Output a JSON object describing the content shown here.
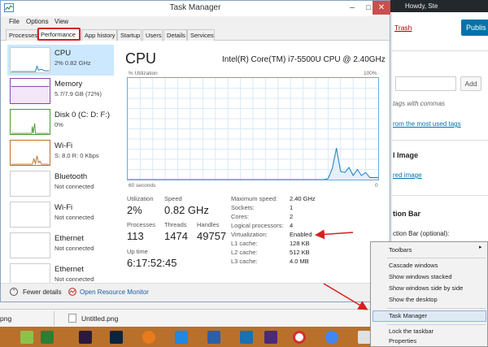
{
  "wp": {
    "admin_user": "Howdy, Ste",
    "trash": "Trash",
    "publish": "Publis",
    "add": "Add",
    "tag_hint": "tags with commas",
    "tag_link": "rom the most used tags",
    "featured": "l Image",
    "featured_link": "red image",
    "action_bar": "tion Bar",
    "action_bar_optional": "ction Bar (optional):"
  },
  "task_manager": {
    "title": "Task Manager",
    "menu": [
      "File",
      "Options",
      "View"
    ],
    "tabs": [
      "Processes",
      "Performance",
      "App history",
      "Startup",
      "Users",
      "Details",
      "Services"
    ],
    "active_tab": "Performance",
    "sidebar": [
      {
        "name": "CPU",
        "sub": "2% 0.82 GHz",
        "selected": true,
        "color": "#1a7bbd"
      },
      {
        "name": "Memory",
        "sub": "5.7/7.9 GB (72%)",
        "color": "#8b3fa9"
      },
      {
        "name": "Disk 0 (C: D: F:)",
        "sub": "0%",
        "color": "#4c9a2a"
      },
      {
        "name": "Wi-Fi",
        "sub": "S: 8.0  R: 0 Kbps",
        "color": "#b9702b"
      },
      {
        "name": "Bluetooth",
        "sub": "Not connected"
      },
      {
        "name": "Wi-Fi",
        "sub": "Not connected"
      },
      {
        "name": "Ethernet",
        "sub": "Not connected"
      },
      {
        "name": "Ethernet",
        "sub": "Not connected"
      }
    ],
    "cpu": {
      "heading": "CPU",
      "model": "Intel(R) Core(TM) i7-5500U CPU @ 2.40GHz",
      "util_label": "% Utilization",
      "util_max": "100%",
      "graph_left": "60 seconds",
      "graph_right": "0",
      "graph_color": "#1a7bbd",
      "util_series": [
        0,
        0,
        0,
        0,
        0,
        0,
        0,
        0,
        0,
        0,
        0,
        0,
        0,
        0,
        0,
        0,
        0,
        0,
        0,
        0,
        0,
        0,
        0,
        0,
        0,
        0,
        0,
        0,
        0,
        0,
        0,
        0,
        0,
        0,
        0,
        0,
        0,
        0,
        0,
        0,
        0,
        0,
        0,
        0,
        0,
        0,
        0,
        0,
        1,
        11,
        31,
        8,
        7,
        12,
        4,
        10,
        4,
        7,
        2,
        2,
        2
      ]
    },
    "stats": {
      "utilization_label": "Utilization",
      "utilization": "2%",
      "speed_label": "Speed",
      "speed": "0.82 GHz",
      "processes_label": "Processes",
      "processes": "113",
      "threads_label": "Threads",
      "threads": "1474",
      "handles_label": "Handles",
      "handles": "49757",
      "uptime_label": "Up time",
      "uptime": "6:17:52:45"
    },
    "details": [
      {
        "label": "Maximum speed:",
        "value": "2.40 GHz"
      },
      {
        "label": "Sockets:",
        "value": "1"
      },
      {
        "label": "Cores:",
        "value": "2"
      },
      {
        "label": "Logical processors:",
        "value": "4"
      },
      {
        "label": "Virtualization:",
        "value": "Enabled"
      },
      {
        "label": "L1 cache:",
        "value": "128 KB"
      },
      {
        "label": "L2 cache:",
        "value": "512 KB"
      },
      {
        "label": "L3 cache:",
        "value": "4.0 MB"
      }
    ],
    "footer": {
      "fewer": "Fewer details",
      "resource_monitor": "Open Resource Monitor"
    }
  },
  "downloads": [
    "png",
    "Untitled.png"
  ],
  "context_menu": {
    "items": [
      "Toolbars",
      "Cascade windows",
      "Show windows stacked",
      "Show windows side by side",
      "Show the desktop",
      "Task Manager",
      "Lock the taskbar",
      "Properties"
    ],
    "highlighted": "Task Manager"
  },
  "annotation_color": "#d42020"
}
